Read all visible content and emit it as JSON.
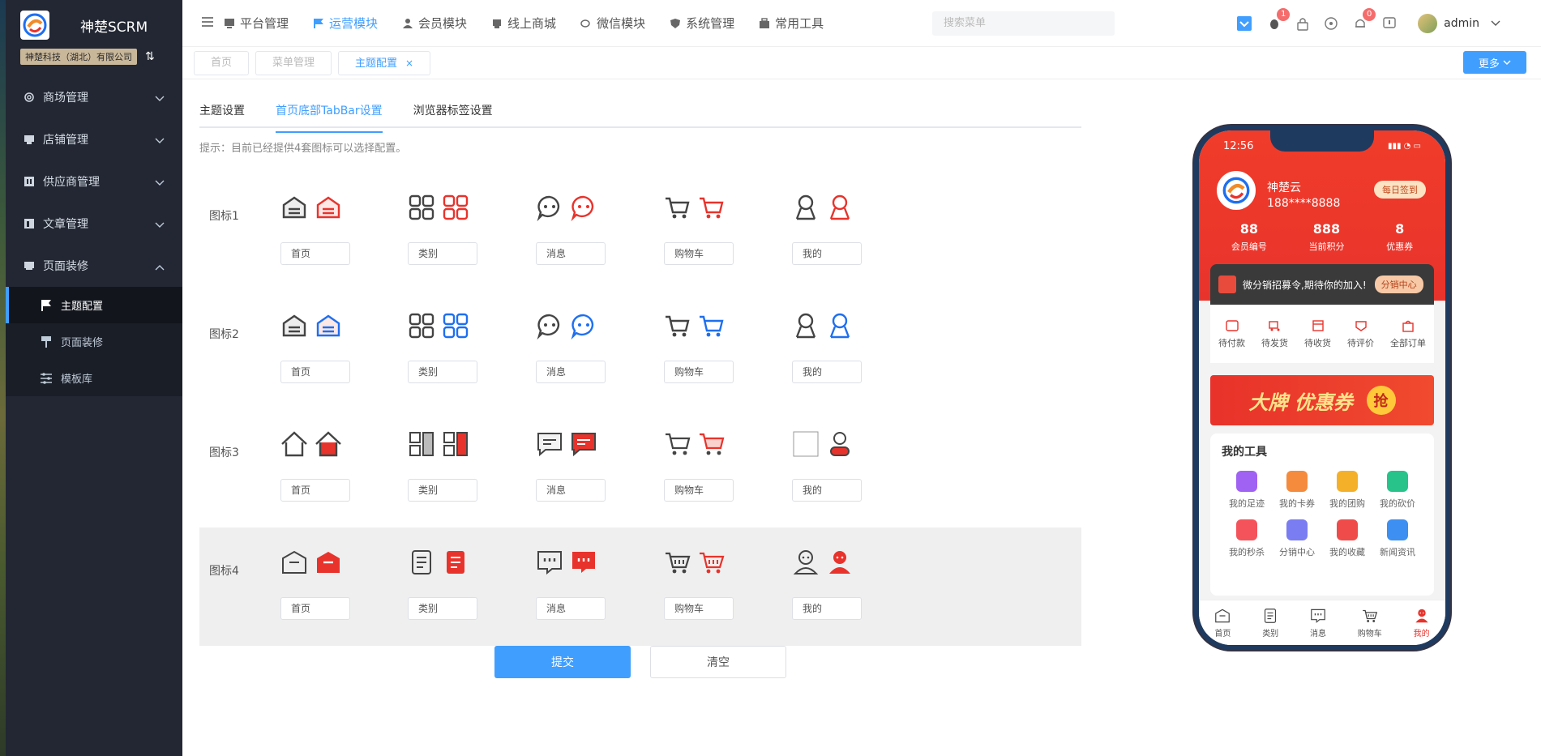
{
  "app": {
    "title": "神楚SCRM",
    "company": "神楚科技（湖北）有限公司"
  },
  "sidebar": {
    "items": [
      {
        "label": "商场管理",
        "icon": "gear-icon"
      },
      {
        "label": "店铺管理",
        "icon": "store-icon"
      },
      {
        "label": "供应商管理",
        "icon": "supplier-icon"
      },
      {
        "label": "文章管理",
        "icon": "article-icon"
      },
      {
        "label": "页面装修",
        "icon": "decor-icon"
      }
    ],
    "subitems": [
      {
        "label": "主题配置",
        "icon": "flag-icon"
      },
      {
        "label": "页面装修",
        "icon": "brush-icon"
      },
      {
        "label": "模板库",
        "icon": "sliders-icon"
      }
    ]
  },
  "topnav": {
    "items": [
      {
        "label": "平台管理"
      },
      {
        "label": "运营模块"
      },
      {
        "label": "会员模块"
      },
      {
        "label": "线上商城"
      },
      {
        "label": "微信模块"
      },
      {
        "label": "系统管理"
      },
      {
        "label": "常用工具"
      }
    ],
    "search_placeholder": "搜索菜单",
    "badges": {
      "bell": "0",
      "bug": "1"
    },
    "user": "admin"
  },
  "tags": {
    "items": [
      "首页",
      "菜单管理",
      "主题配置"
    ],
    "close": "×",
    "more": "更多"
  },
  "tabs": {
    "items": [
      "主题设置",
      "首页底部TabBar设置",
      "浏览器标签设置"
    ]
  },
  "hint": "提示：目前已经提供4套图标可以选择配置。",
  "icon_sets": [
    {
      "label": "图标1",
      "names": [
        "首页",
        "类别",
        "消息",
        "购物车",
        "我的"
      ]
    },
    {
      "label": "图标2",
      "names": [
        "首页",
        "类别",
        "消息",
        "购物车",
        "我的"
      ]
    },
    {
      "label": "图标3",
      "names": [
        "首页",
        "类别",
        "消息",
        "购物车",
        "我的"
      ]
    },
    {
      "label": "图标4",
      "names": [
        "首页",
        "类别",
        "消息",
        "购物车",
        "我的"
      ]
    }
  ],
  "buttons": {
    "submit": "提交",
    "clear": "清空"
  },
  "colors": {
    "accent": "#409eff",
    "red": "#e8332c",
    "blue": "#1e6ff0",
    "dark": "#444444"
  },
  "phone": {
    "time": "12:56",
    "name": "神楚云",
    "phone": "188****8888",
    "signin": "每日签到",
    "stats": [
      {
        "value": "88",
        "label": "会员编号"
      },
      {
        "value": "888",
        "label": "当前积分"
      },
      {
        "value": "8",
        "label": "优惠券"
      }
    ],
    "distribution": {
      "text": "微分销招募令,期待你的加入!",
      "button": "分销中心"
    },
    "orders": [
      "待付款",
      "待发货",
      "待收货",
      "待评价",
      "全部订单"
    ],
    "banner": {
      "text": "大牌 优惠券",
      "badge": "抢"
    },
    "tools_title": "我的工具",
    "tools": [
      {
        "label": "我的足迹",
        "color": "#a062f2"
      },
      {
        "label": "我的卡券",
        "color": "#f48b3d"
      },
      {
        "label": "我的团购",
        "color": "#f5b02a"
      },
      {
        "label": "我的砍价",
        "color": "#28c38a"
      },
      {
        "label": "我的秒杀",
        "color": "#f5535b"
      },
      {
        "label": "分销中心",
        "color": "#7a7cf2"
      },
      {
        "label": "我的收藏",
        "color": "#f04b4b"
      },
      {
        "label": "新闻资讯",
        "color": "#3d8ff2"
      }
    ],
    "tabbar": [
      "首页",
      "类别",
      "消息",
      "购物车",
      "我的"
    ]
  }
}
